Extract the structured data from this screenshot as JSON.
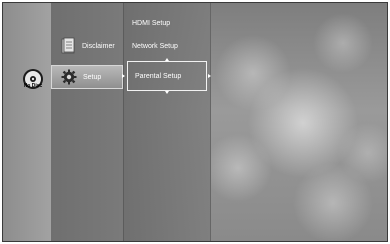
{
  "disc": {
    "label": "No Disc",
    "icon": "disc-icon"
  },
  "main_menu": {
    "items": [
      {
        "label": "Disclaimer",
        "icon": "document-icon",
        "selected": false
      },
      {
        "label": "Setup",
        "icon": "gear-icon",
        "selected": true
      }
    ]
  },
  "sub_menu": {
    "items": [
      {
        "label": "HDMI Setup",
        "selected": false
      },
      {
        "label": "Network Setup",
        "selected": false
      },
      {
        "label": "Parental Setup",
        "selected": true
      }
    ]
  },
  "colors": {
    "selection_border": "#f2f2f2",
    "text": "#ffffff"
  }
}
